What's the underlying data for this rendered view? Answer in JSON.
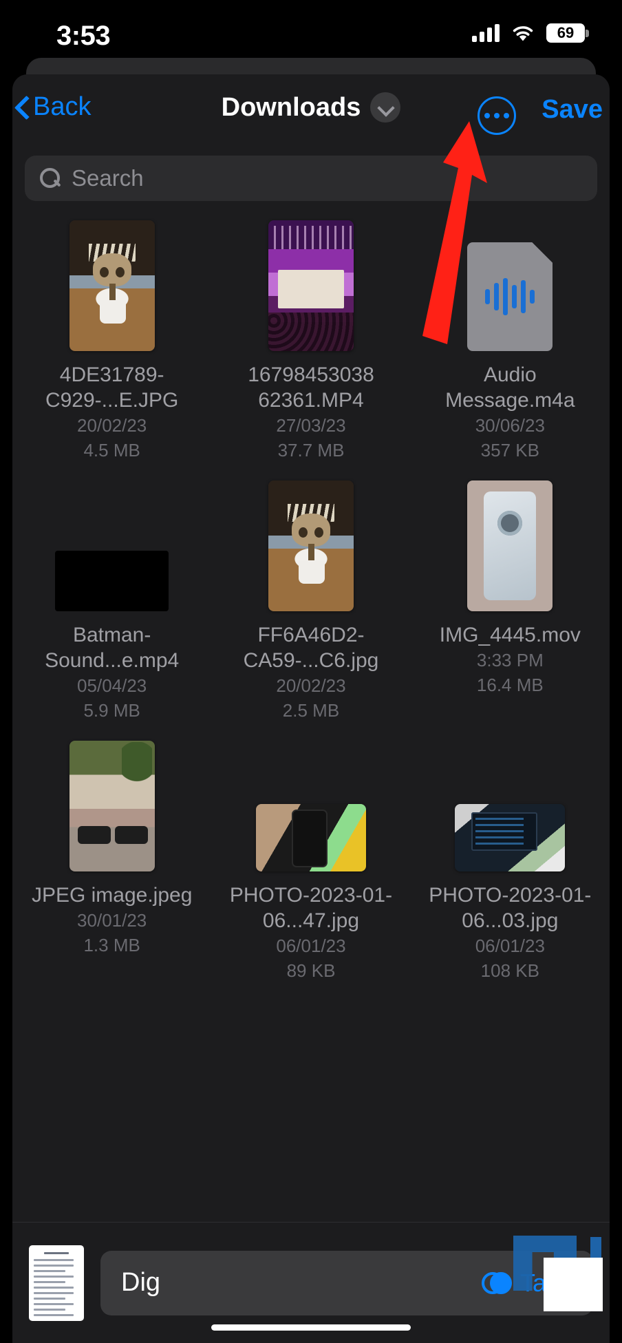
{
  "statusbar": {
    "time": "3:53",
    "battery_level": "69",
    "signal_icon": "cellular-bars-icon",
    "wifi_icon": "wifi-icon",
    "battery_icon": "battery-icon"
  },
  "navbar": {
    "back_label": "Back",
    "title": "Downloads",
    "title_chevron_icon": "chevron-down-icon",
    "more_icon": "ellipsis-circle-icon",
    "save_label": "Save"
  },
  "search": {
    "placeholder": "Search",
    "icon": "search-icon"
  },
  "files": [
    {
      "name": "4DE31789-C929-...E.JPG",
      "date": "20/02/23",
      "size": "4.5 MB",
      "thumb": "photo-groot-portrait"
    },
    {
      "name": "16798453038 62361.MP4",
      "date": "27/03/23",
      "size": "37.7 MB",
      "thumb": "video-concert-portrait"
    },
    {
      "name": "Audio Message.m4a",
      "date": "30/06/23",
      "size": "357 KB",
      "thumb": "audio-document-icon"
    },
    {
      "name": "Batman-Sound...e.mp4",
      "date": "05/04/23",
      "size": "5.9 MB",
      "thumb": "video-black-wide"
    },
    {
      "name": "FF6A46D2-CA59-...C6.jpg",
      "date": "20/02/23",
      "size": "2.5 MB",
      "thumb": "photo-groot-portrait"
    },
    {
      "name": "IMG_4445.mov",
      "date": "3:33 PM",
      "size": "16.4 MB",
      "thumb": "photo-phone-portrait"
    },
    {
      "name": "JPEG image.jpeg",
      "date": "30/01/23",
      "size": "1.3 MB",
      "thumb": "photo-bikes-portrait"
    },
    {
      "name": "PHOTO-2023-01-06...47.jpg",
      "date": "06/01/23",
      "size": "89 KB",
      "thumb": "photo-phone-desk-wide"
    },
    {
      "name": "PHOTO-2023-01-06...03.jpg",
      "date": "06/01/23",
      "size": "108 KB",
      "thumb": "photo-laptop-wide"
    }
  ],
  "bottombar": {
    "document_preview_icon": "document-preview-thumbnail",
    "filename_value": "Dig",
    "tags_label": "Tags",
    "tags_icon": "tags-circles-icon"
  },
  "annotation": {
    "arrow_icon": "red-arrow-pointing-up-right",
    "arrow_color": "#ff2116"
  },
  "colors": {
    "accent_blue": "#0a84ff",
    "sheet_background": "#1c1c1e",
    "field_background": "#2c2c2e",
    "primary_text": "#ffffff",
    "secondary_text": "#a0a0a5",
    "tertiary_text": "#6a6a70"
  }
}
